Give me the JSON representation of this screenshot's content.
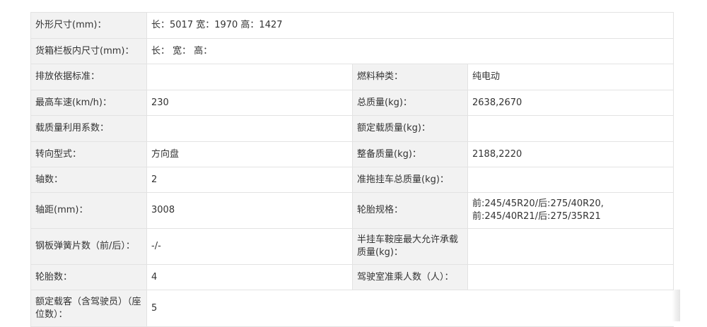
{
  "spec": {
    "dims": {
      "label": "外形尺寸(mm)：",
      "value": "长：5017 宽：1970 高：1427"
    },
    "cargo": {
      "label": "货箱栏板内尺寸(mm)：",
      "value": "长： 宽： 高："
    },
    "rows": [
      {
        "l1": "排放依据标准：",
        "v1": "",
        "l2": "燃料种类：",
        "v2": "纯电动"
      },
      {
        "l1": "最高车速(km/h)：",
        "v1": "230",
        "l2": "总质量(kg)：",
        "v2": "2638,2670"
      },
      {
        "l1": "载质量利用系数：",
        "v1": "",
        "l2": "额定载质量(kg)：",
        "v2": ""
      },
      {
        "l1": "转向型式：",
        "v1": "方向盘",
        "l2": "整备质量(kg)：",
        "v2": "2188,2220"
      },
      {
        "l1": "轴数：",
        "v1": "2",
        "l2": "准拖挂车总质量(kg)：",
        "v2": ""
      },
      {
        "l1": "轴距(mm)：",
        "v1": "3008",
        "l2": "轮胎规格：",
        "v2": "前:245/45R20/后:275/40R20,前:245/40R21/后:275/35R21"
      },
      {
        "l1": "钢板弹簧片数（前/后）：",
        "v1": "-/-",
        "l2": "半挂车鞍座最大允许承载质量(kg)：",
        "v2": ""
      },
      {
        "l1": "轮胎数：",
        "v1": "4",
        "l2": "驾驶室准乘人数（人）：",
        "v2": ""
      }
    ],
    "seats": {
      "label": "额定载客（含驾驶员）（座位数）：",
      "value": "5"
    }
  }
}
